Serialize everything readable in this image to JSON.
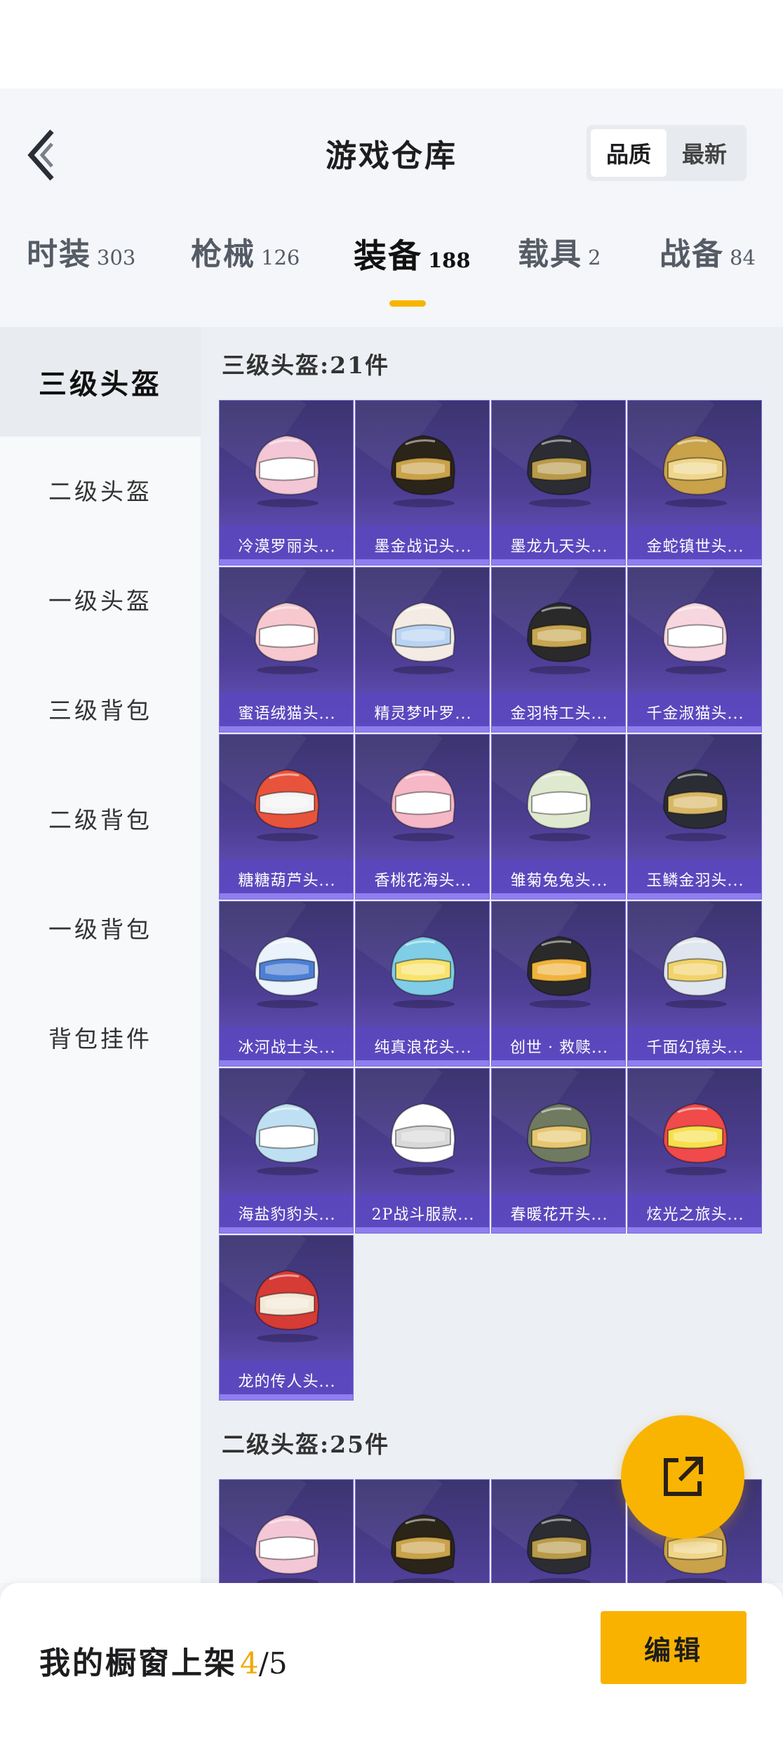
{
  "header": {
    "title": "游戏仓库",
    "sort_options": [
      "品质",
      "最新"
    ],
    "sort_active": "品质"
  },
  "tabs": [
    {
      "label": "时装",
      "count": "303"
    },
    {
      "label": "枪械",
      "count": "126"
    },
    {
      "label": "装备",
      "count": "188"
    },
    {
      "label": "载具",
      "count": "2"
    },
    {
      "label": "战备",
      "count": "84"
    }
  ],
  "active_tab": "装备",
  "sidebar": {
    "items": [
      "三级头盔",
      "二级头盔",
      "一级头盔",
      "三级背包",
      "二级背包",
      "一级背包",
      "背包挂件"
    ],
    "active": "三级头盔"
  },
  "sections": [
    {
      "title": "三级头盔:21件",
      "items": [
        "冷漠罗丽头...",
        "墨金战记头...",
        "墨龙九天头...",
        "金蛇镇世头...",
        "蜜语绒猫头...",
        "精灵梦叶罗...",
        "金羽特工头...",
        "千金淑猫头...",
        "糖糖葫芦头...",
        "香桃花海头...",
        "雏菊兔兔头...",
        "玉鳞金羽头...",
        "冰河战士头...",
        "纯真浪花头...",
        "创世 · 救赎...",
        "千面幻镜头...",
        "海盐豹豹头...",
        "2P战斗服款...",
        "春暖花开头...",
        "炫光之旅头...",
        "龙的传人头..."
      ]
    },
    {
      "title": "二级头盔:25件",
      "items": [
        "",
        "",
        "",
        ""
      ]
    }
  ],
  "bottom_bar": {
    "label": "我的橱窗上架",
    "count": "4",
    "separator": "/",
    "total": "5",
    "edit_label": "编辑"
  },
  "colors": {
    "accent": "#f8b400",
    "card_bg": "#4d3e93",
    "card_label_bg": "#5a46be"
  },
  "icons": {
    "back": "chevron-left-icon",
    "fab": "share-export-icon"
  }
}
